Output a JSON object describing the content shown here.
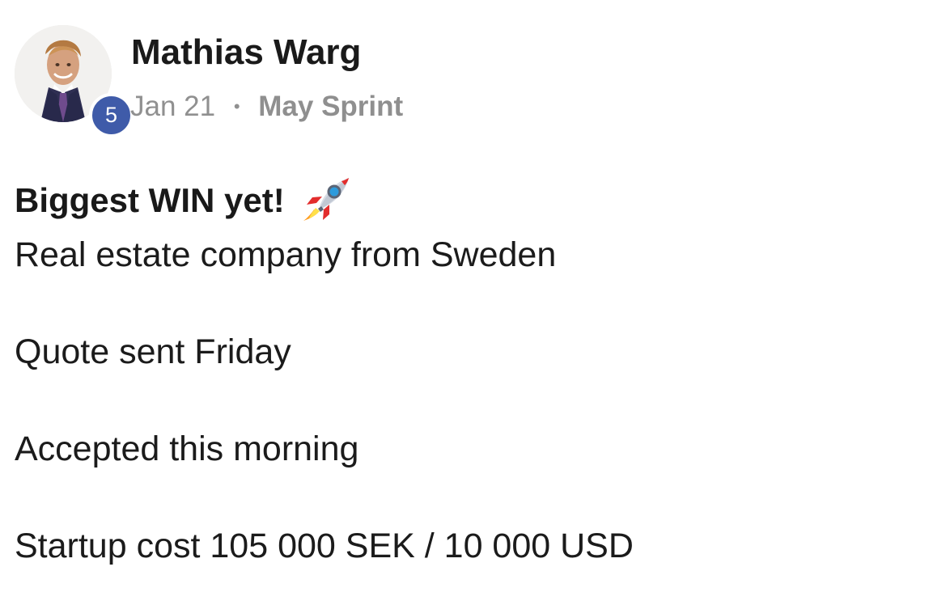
{
  "post": {
    "author": {
      "name": "Mathias Warg",
      "level": "5",
      "avatar_icon": "profile-photo-icon"
    },
    "meta": {
      "date": "Jan 21",
      "separator": "•",
      "category": "May Sprint"
    },
    "title": "Biggest WIN yet!",
    "title_emoji": "rocket-icon",
    "body_lines": [
      "Real estate company from Sweden",
      "Quote sent Friday",
      "Accepted this morning",
      "Startup cost 105 000 SEK / 10 000 USD"
    ]
  },
  "colors": {
    "background": "#ffffff",
    "primary_text": "#1b1b1b",
    "secondary_text": "#909090",
    "level_badge": "#3f5ba9"
  }
}
